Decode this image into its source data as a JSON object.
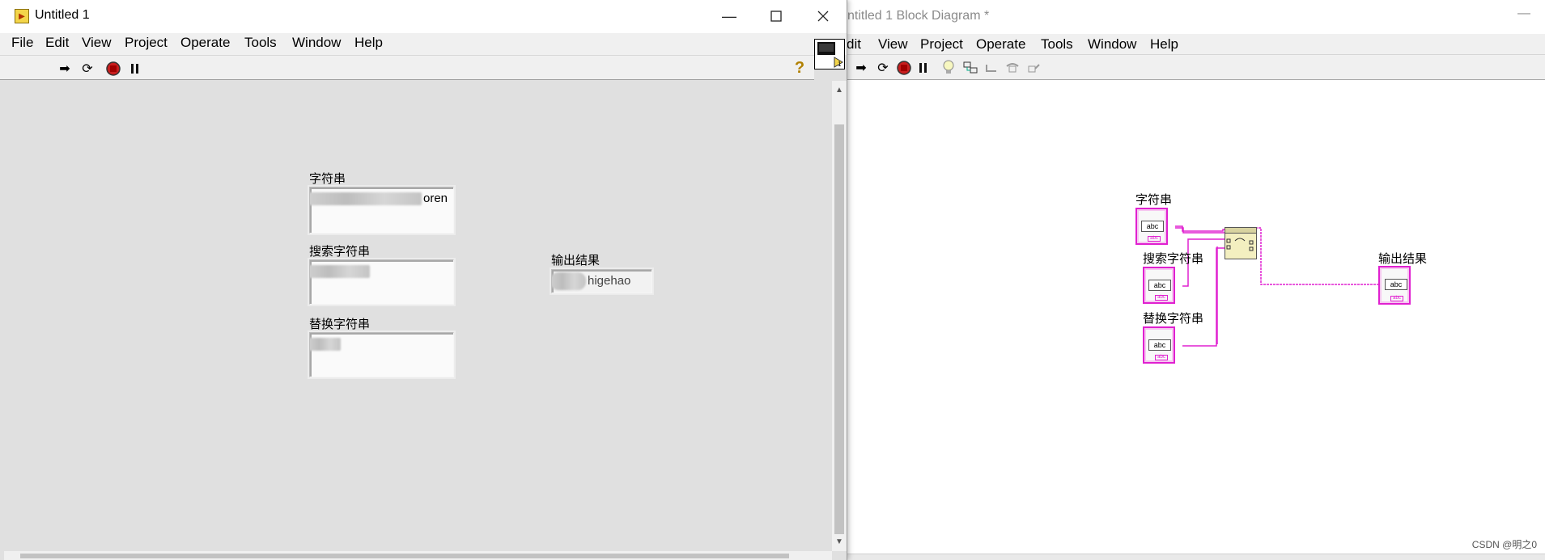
{
  "front_panel": {
    "title": "Untitled 1",
    "menu": [
      "File",
      "Edit",
      "View",
      "Project",
      "Operate",
      "Tools",
      "Window",
      "Help"
    ],
    "controls": [
      {
        "label": "字符串",
        "visible_text": "oren"
      },
      {
        "label": "搜索字符串",
        "visible_text": ""
      },
      {
        "label": "替换字符串",
        "visible_text": ""
      }
    ],
    "indicator": {
      "label": "输出结果",
      "visible_text": "higehao"
    },
    "toolbar_icons": [
      "run-arrow-icon",
      "run-continuously-icon",
      "abort-icon",
      "pause-icon",
      "help-icon"
    ]
  },
  "block_diagram": {
    "title": "ntitled 1 Block Diagram *",
    "menu": [
      "dit",
      "View",
      "Project",
      "Operate",
      "Tools",
      "Window",
      "Help"
    ],
    "terminals": [
      {
        "label": "字符串",
        "type_text": "abc"
      },
      {
        "label": "搜索字符串",
        "type_text": "abc"
      },
      {
        "label": "替换字符串",
        "type_text": "abc"
      },
      {
        "label": "输出结果",
        "type_text": "abc"
      }
    ],
    "wire_color": "#e020d0"
  },
  "watermark": "CSDN @明之0"
}
